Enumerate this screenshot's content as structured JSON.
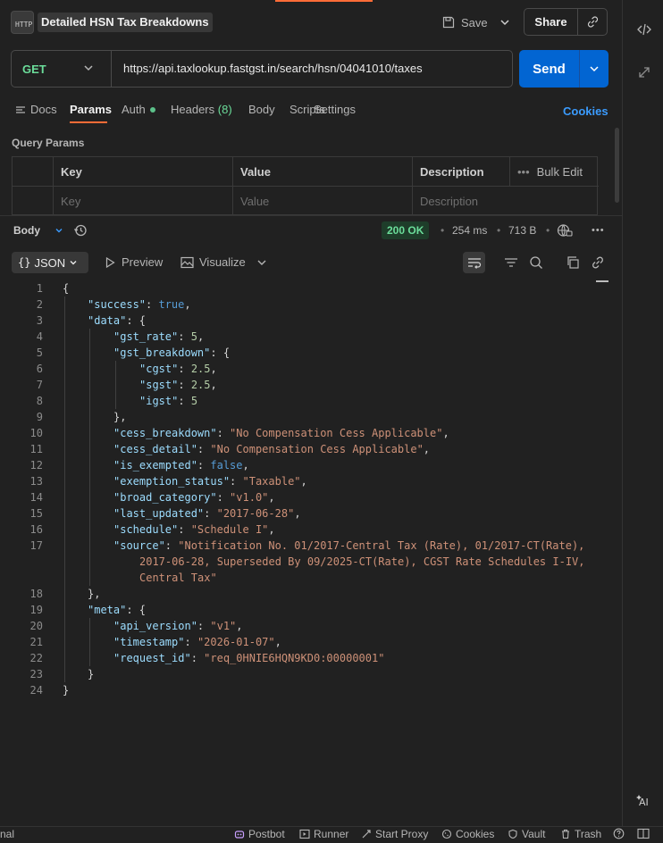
{
  "header": {
    "request_title": "Detailed HSN Tax Breakdowns",
    "save_label": "Save",
    "share_label": "Share"
  },
  "request": {
    "method": "GET",
    "url": "https://api.taxlookup.fastgst.in/search/hsn/04041010/taxes",
    "send_label": "Send"
  },
  "tabs": [
    {
      "label": "Docs"
    },
    {
      "label": "Params"
    },
    {
      "label": "Auth"
    },
    {
      "label": "Headers",
      "count": "(8)"
    },
    {
      "label": "Body"
    },
    {
      "label": "Scripts"
    },
    {
      "label": "Settings"
    }
  ],
  "cookies_label": "Cookies",
  "query_params": {
    "label": "Query Params",
    "columns": [
      "Key",
      "Value",
      "Description"
    ],
    "bulk_edit": "Bulk Edit",
    "placeholders": {
      "key": "Key",
      "value": "Value",
      "description": "Description"
    }
  },
  "response": {
    "body_label": "Body",
    "status": "200 OK",
    "time": "254 ms",
    "size": "713 B",
    "format": "JSON",
    "preview_label": "Preview",
    "visualize_label": "Visualize"
  },
  "code_lines": [
    "1",
    "2",
    "3",
    "4",
    "5",
    "6",
    "7",
    "8",
    "9",
    "10",
    "11",
    "12",
    "13",
    "14",
    "15",
    "16",
    "17",
    "18",
    "19",
    "20",
    "21",
    "22",
    "23",
    "24"
  ],
  "json": {
    "success": "true",
    "gst_rate": "5",
    "cgst": "2.5",
    "sgst": "2.5",
    "igst": "5",
    "cess_breakdown": "\"No Compensation Cess Applicable\"",
    "cess_detail": "\"No Compensation Cess Applicable\"",
    "is_exempted": "false",
    "exemption_status": "\"Taxable\"",
    "broad_category": "\"v1.0\"",
    "last_updated": "\"2017-06-28\"",
    "schedule": "\"Schedule I\"",
    "source_1": "\"Notification No. 01/2017-Central Tax (Rate), 01/2017-CT(Rate),",
    "source_2": "2017-06-28, Superseded By 09/2025-CT(Rate), CGST Rate Schedules I-IV,",
    "source_3": "Central Tax\"",
    "api_version": "\"v1\"",
    "timestamp": "\"2026-01-07\"",
    "request_id": "\"req_0HNIE6HQN9KD0:00000001\""
  },
  "statusbar": {
    "left_text": "nal",
    "postbot": "Postbot",
    "runner": "Runner",
    "start_proxy": "Start Proxy",
    "cookies": "Cookies",
    "vault": "Vault",
    "trash": "Trash"
  },
  "colors": {
    "accent": "#ff6c37",
    "send": "#0265d2",
    "get": "#6bdd9a",
    "link": "#3b9cff"
  }
}
